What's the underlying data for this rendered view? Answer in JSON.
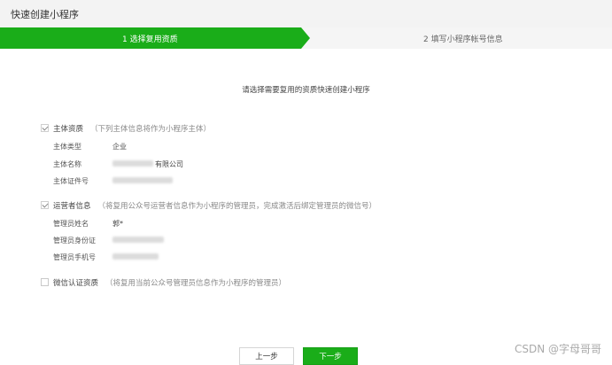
{
  "window": {
    "title": "快速创建小程序"
  },
  "steps": [
    {
      "label": "1 选择复用资质",
      "active": true
    },
    {
      "label": "2 填写小程序帐号信息",
      "active": false
    }
  ],
  "intro": "请选择需要复用的资质快速创建小程序",
  "sections": {
    "entity": {
      "label": "主体资质",
      "note": "（下列主体信息将作为小程序主体）",
      "checked": true,
      "rows": [
        {
          "label": "主体类型",
          "value": "企业"
        },
        {
          "label": "主体名称",
          "value": "有限公司"
        },
        {
          "label": "主体证件号",
          "value": ""
        }
      ]
    },
    "operator": {
      "label": "运营者信息",
      "note": "（将复用公众号运营者信息作为小程序的管理员，完成激活后绑定管理员的微信号）",
      "checked": true,
      "rows": [
        {
          "label": "管理员姓名",
          "value": "郭*"
        },
        {
          "label": "管理员身份证",
          "value": ""
        },
        {
          "label": "管理员手机号",
          "value": ""
        }
      ]
    },
    "wechat_cert": {
      "label": "微信认证资质",
      "note": "（将复用当前公众号管理员信息作为小程序的管理员）",
      "checked": false
    }
  },
  "buttons": {
    "prev": "上一步",
    "next": "下一步"
  },
  "watermark": "CSDN @字母哥哥",
  "colors": {
    "accent": "#1aad19"
  }
}
